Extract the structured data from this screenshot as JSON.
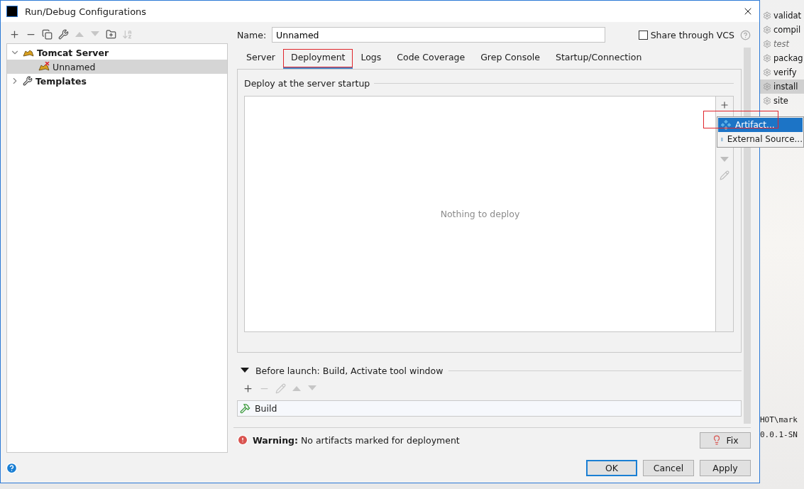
{
  "window": {
    "title": "Run/Debug Configurations"
  },
  "toolbar": [
    {
      "kind": "add",
      "disabled": false
    },
    {
      "kind": "remove",
      "disabled": false
    },
    {
      "kind": "copy",
      "disabled": false
    },
    {
      "kind": "edit-defaults",
      "disabled": false
    },
    {
      "kind": "up",
      "disabled": true
    },
    {
      "kind": "down",
      "disabled": true
    },
    {
      "kind": "folder",
      "disabled": false
    },
    {
      "kind": "sort",
      "disabled": true
    }
  ],
  "tree": [
    {
      "label": "Tomcat Server",
      "kind": "tomcat",
      "expanded": true,
      "selected": false,
      "children": [
        {
          "label": "Unnamed",
          "kind": "tomcat-error",
          "selected": true
        }
      ]
    },
    {
      "label": "Templates",
      "kind": "wrench",
      "expanded": false,
      "selected": false
    }
  ],
  "name_field": {
    "label": "Name:",
    "value": "Unnamed"
  },
  "share": {
    "label": "Share through VCS",
    "checked": false
  },
  "tabs": [
    {
      "label": "Server",
      "selected": false,
      "highlighted": false
    },
    {
      "label": "Deployment",
      "selected": true,
      "highlighted": true
    },
    {
      "label": "Logs",
      "selected": false,
      "highlighted": false
    },
    {
      "label": "Code Coverage",
      "selected": false,
      "highlighted": false
    },
    {
      "label": "Grep Console",
      "selected": false,
      "highlighted": false
    },
    {
      "label": "Startup/Connection",
      "selected": false,
      "highlighted": false
    }
  ],
  "deploy": {
    "title": "Deploy at the server startup",
    "empty_text": "Nothing to deploy",
    "side_toolbar": [
      {
        "kind": "add",
        "disabled": false
      },
      {
        "kind": "down",
        "disabled": true
      },
      {
        "kind": "edit",
        "disabled": true
      }
    ]
  },
  "popup_menu": [
    {
      "label": "Artifact...",
      "kind": "artifact",
      "selected": true,
      "highlighted": true
    },
    {
      "label": "External Source...",
      "kind": "external",
      "selected": false,
      "highlighted": false
    }
  ],
  "before_launch": {
    "title": "Before launch: Build, Activate tool window",
    "expanded": true,
    "toolbar": [
      {
        "kind": "add",
        "disabled": false
      },
      {
        "kind": "remove",
        "disabled": true
      },
      {
        "kind": "edit",
        "disabled": true
      },
      {
        "kind": "up",
        "disabled": true
      },
      {
        "kind": "down",
        "disabled": true
      }
    ],
    "tasks": [
      {
        "label": "Build"
      }
    ]
  },
  "warning": {
    "label": "Warning:",
    "text": "No artifacts marked for deployment"
  },
  "fix_button": "Fix",
  "buttons": [
    {
      "label": "OK",
      "default": true
    },
    {
      "label": "Cancel",
      "default": false
    },
    {
      "label": "Apply",
      "default": false
    }
  ],
  "background": {
    "goals": [
      {
        "label": "validat",
        "selected": false,
        "disabled": false
      },
      {
        "label": "compil",
        "selected": false,
        "disabled": false
      },
      {
        "label": "test",
        "selected": false,
        "disabled": true
      },
      {
        "label": "packag",
        "selected": false,
        "disabled": false
      },
      {
        "label": "verify",
        "selected": false,
        "disabled": false
      },
      {
        "label": "install",
        "selected": true,
        "disabled": false
      },
      {
        "label": "site",
        "selected": false,
        "disabled": false
      }
    ],
    "console_lines": [
      "HOT\\mark",
      "0.0.1-SN"
    ]
  }
}
